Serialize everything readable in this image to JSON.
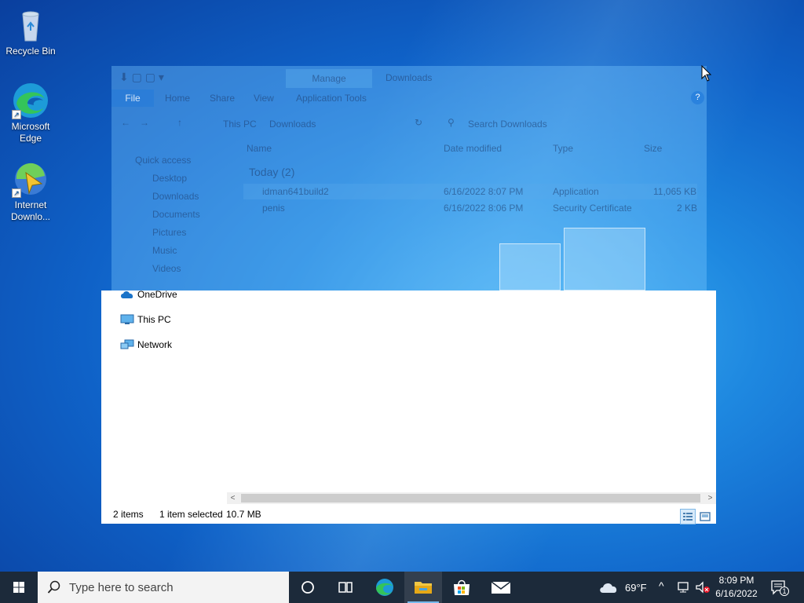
{
  "desktop": {
    "icons": [
      {
        "label": "Recycle Bin",
        "icon": "recycle-bin-icon"
      },
      {
        "label": "Microsoft Edge",
        "icon": "edge-icon"
      },
      {
        "label": "Internet Downlo...",
        "icon": "idm-icon"
      }
    ]
  },
  "explorer": {
    "title": "Downloads",
    "context_tab": "Manage",
    "ribbon_tabs": [
      "File",
      "Home",
      "Share",
      "View",
      "Application Tools"
    ],
    "address": {
      "parts": [
        "This PC",
        "Downloads"
      ]
    },
    "search_placeholder": "Search Downloads",
    "nav_pane": {
      "quick_access": "Quick access",
      "quick_items": [
        "Desktop",
        "Downloads",
        "Documents",
        "Pictures",
        "Music",
        "Videos"
      ],
      "items": [
        "OneDrive",
        "This PC",
        "Network"
      ]
    },
    "columns": [
      "Name",
      "Date modified",
      "Type",
      "Size"
    ],
    "group_header": "Today (2)",
    "files": [
      {
        "name": "idman641build2",
        "date": "6/16/2022 8:07 PM",
        "type": "Application",
        "size": "11,065 KB"
      },
      {
        "name": "penis",
        "date": "6/16/2022 8:06 PM",
        "type": "Security Certificate",
        "size": "2 KB"
      }
    ],
    "status": {
      "count": "2 items",
      "selected": "1 item selected",
      "size": "10.7 MB"
    }
  },
  "taskbar": {
    "search_placeholder": "Type here to search",
    "weather": "69°F",
    "time": "8:09 PM",
    "date": "6/16/2022",
    "notification_count": "1"
  },
  "colors": {
    "accent": "#0078d7",
    "taskbar": "#1c2a3a"
  }
}
